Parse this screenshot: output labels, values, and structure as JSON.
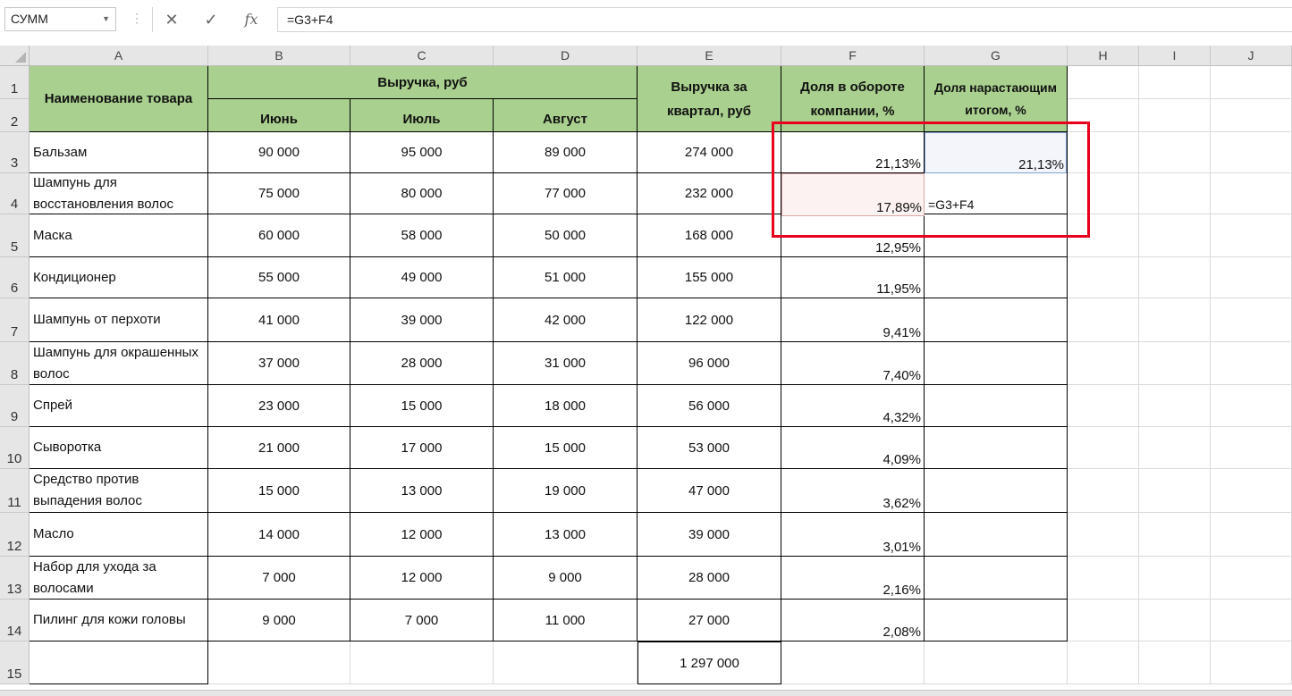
{
  "formula_bar": {
    "name_box": "СУММ",
    "formula": "=G3+F4",
    "fx_label": "fx"
  },
  "columns": [
    "A",
    "B",
    "C",
    "D",
    "E",
    "F",
    "G",
    "H",
    "I",
    "J"
  ],
  "rows": [
    "1",
    "2",
    "3",
    "4",
    "5",
    "6",
    "7",
    "8",
    "9",
    "10",
    "11",
    "12",
    "13",
    "14",
    "15"
  ],
  "headers": {
    "name": "Наименование товара",
    "revenue": "Выручка, руб",
    "june": "Июнь",
    "july": "Июль",
    "august": "Август",
    "quarter": "Выручка за квартал, руб",
    "share": "Доля в обороте компании, %",
    "cumulative": "Доля нарастающим итогом, %"
  },
  "table_rows": [
    {
      "name": "Бальзам",
      "june": "90 000",
      "july": "95 000",
      "august": "89 000",
      "quarter": "274 000",
      "share": "21,13%",
      "cumulative": "21,13%"
    },
    {
      "name": "Шампунь для восстановления волос",
      "june": "75 000",
      "july": "80 000",
      "august": "77 000",
      "quarter": "232 000",
      "share": "17,89%",
      "cumulative": "=G3+F4"
    },
    {
      "name": "Маска",
      "june": "60 000",
      "july": "58 000",
      "august": "50 000",
      "quarter": "168 000",
      "share": "12,95%",
      "cumulative": ""
    },
    {
      "name": "Кондиционер",
      "june": "55 000",
      "july": "49 000",
      "august": "51 000",
      "quarter": "155 000",
      "share": "11,95%",
      "cumulative": ""
    },
    {
      "name": "Шампунь от перхоти",
      "june": "41 000",
      "july": "39 000",
      "august": "42 000",
      "quarter": "122 000",
      "share": "9,41%",
      "cumulative": ""
    },
    {
      "name": "Шампунь для окрашенных волос",
      "june": "37 000",
      "july": "28 000",
      "august": "31 000",
      "quarter": "96 000",
      "share": "7,40%",
      "cumulative": ""
    },
    {
      "name": "Спрей",
      "june": "23 000",
      "july": "15 000",
      "august": "18 000",
      "quarter": "56 000",
      "share": "4,32%",
      "cumulative": ""
    },
    {
      "name": "Сыворотка",
      "june": "21 000",
      "july": "17 000",
      "august": "15 000",
      "quarter": "53 000",
      "share": "4,09%",
      "cumulative": ""
    },
    {
      "name": "Средство против выпадения волос",
      "june": "15 000",
      "july": "13 000",
      "august": "19 000",
      "quarter": "47 000",
      "share": "3,62%",
      "cumulative": ""
    },
    {
      "name": "Масло",
      "june": "14 000",
      "july": "12 000",
      "august": "13 000",
      "quarter": "39 000",
      "share": "3,01%",
      "cumulative": ""
    },
    {
      "name": "Набор для ухода за волосами",
      "june": "7 000",
      "july": "12 000",
      "august": "9 000",
      "quarter": "28 000",
      "share": "2,16%",
      "cumulative": ""
    },
    {
      "name": "Пилинг для кожи головы",
      "june": "9 000",
      "july": "7 000",
      "august": "11 000",
      "quarter": "27 000",
      "share": "2,08%",
      "cumulative": ""
    }
  ],
  "total": {
    "quarter": "1 297 000"
  },
  "colors": {
    "header_fill": "#a9d08e",
    "highlight_box": "#e8001c"
  }
}
